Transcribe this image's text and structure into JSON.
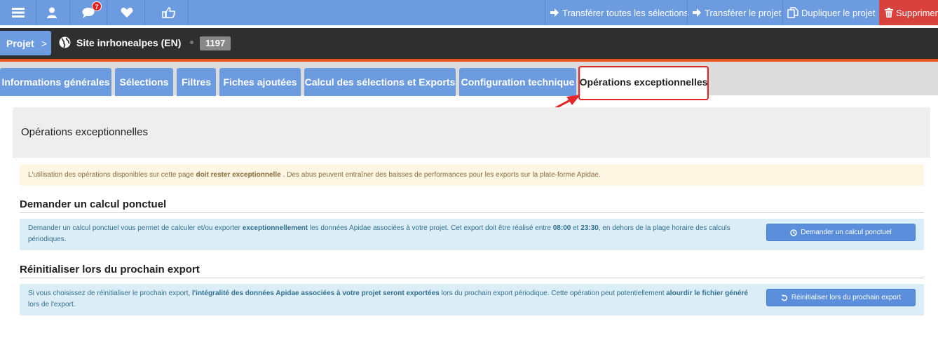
{
  "topbar": {
    "icons": [
      "menu-icon",
      "user-icon",
      "comments-icon",
      "heart-icon",
      "thumbs-up-icon"
    ],
    "notification_count": "7",
    "actions": {
      "transfer_all": "Transférer toutes les sélections",
      "transfer_project": "Transférer le projet",
      "duplicate_project": "Dupliquer le projet",
      "delete": "Supprimer"
    }
  },
  "project": {
    "label": "Projet",
    "chevron": ">",
    "site_name": "Site inrhonealpes (EN)",
    "id": "1197"
  },
  "tabs": [
    {
      "label": "Informations générales",
      "active": false
    },
    {
      "label": "Sélections",
      "active": false
    },
    {
      "label": "Filtres",
      "active": false
    },
    {
      "label": "Fiches ajoutées",
      "active": false
    },
    {
      "label": "Calcul des sélections et Exports",
      "active": false
    },
    {
      "label": "Configuration technique",
      "active": false
    },
    {
      "label": "Opérations exceptionnelles",
      "active": true
    }
  ],
  "panel": {
    "title": "Opérations exceptionnelles",
    "warning": {
      "part1": "L'utilisation des opérations disponibles sur cette page",
      "bold": "doit rester exceptionnelle",
      "part2": ". Des abus peuvent entraîner des baisses de performances pour les exports sur la plate-forme Apidae."
    }
  },
  "sections": {
    "calcul": {
      "title": "Demander un calcul ponctuel",
      "text1": "Demander un calcul ponctuel vous permet de calculer et/ou exporter",
      "bold1": "exceptionnellement",
      "text2": "les données Apidae associées à votre projet. Cet export doit être réalisé entre",
      "bold2": "08:00",
      "text3": "et",
      "bold3": "23:30",
      "text4": ", en dehors de la plage horaire des calculs périodiques.",
      "button": "Demander un calcul ponctuel"
    },
    "reinit": {
      "title": "Réinitialiser lors du prochain export",
      "text1": "Si vous choisissez de réinitialiser le prochain export,",
      "bold1": "l'intégralité des données Apidae associées à votre projet seront exportées",
      "text2": "lors du prochain export périodique. Cette opération peut potentiellement",
      "bold2": "alourdir le fichier généré",
      "text3": "lors de l'export.",
      "button": "Réinitialiser lors du prochain export"
    }
  },
  "colors": {
    "primary": "#6d9be0",
    "danger": "#d9413c",
    "accent_strip": "#e8541c",
    "highlight": "#e3262a"
  }
}
